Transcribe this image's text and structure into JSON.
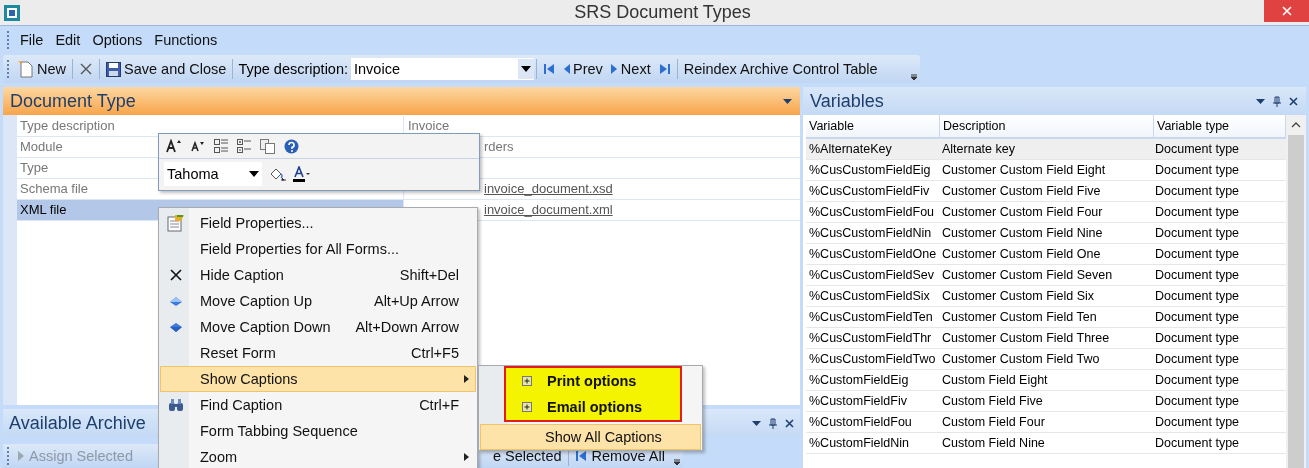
{
  "window": {
    "title": "SRS Document Types"
  },
  "menu": [
    "File",
    "Edit",
    "Options",
    "Functions"
  ],
  "toolbar": {
    "new": "New",
    "save": "Save and Close",
    "type_label": "Type description:",
    "type_value": "Invoice",
    "prev": "Prev",
    "next": "Next",
    "reindex": "Reindex Archive Control Table"
  },
  "document_type": {
    "title": "Document Type",
    "fields": [
      {
        "label": "Type description",
        "value": "Invoice",
        "link": false,
        "selected": false
      },
      {
        "label": "Module",
        "value": "rders",
        "link": false,
        "selected": false
      },
      {
        "label": "Type",
        "selected": false
      },
      {
        "label": "Schema file",
        "value": "invoice_document.xsd",
        "link": true,
        "selected": false
      },
      {
        "label": "XML file",
        "value": "invoice_document.xml",
        "link": true,
        "selected": true
      }
    ]
  },
  "archive": {
    "title": "Available Archive",
    "toolbar": [
      {
        "label": "Assign Selected",
        "disabled": true
      },
      {
        "label": "e Selected",
        "disabled": false
      },
      {
        "label": "Remove All",
        "disabled": false
      }
    ]
  },
  "mini_toolbar": {
    "font": "Tahoma"
  },
  "context_menu": {
    "items": [
      {
        "kind": "properties",
        "label": "Field Properties...",
        "selected": false
      },
      {
        "kind": "plain",
        "label": "Field Properties for All Forms...",
        "selected": false
      },
      {
        "kind": "hide",
        "label": "Hide Caption",
        "shortcut": "Shift+Del",
        "selected": false
      },
      {
        "kind": "up",
        "label": "Move Caption Up",
        "shortcut": "Alt+Up Arrow",
        "selected": false
      },
      {
        "kind": "down",
        "label": "Move Caption Down",
        "shortcut": "Alt+Down Arrow",
        "selected": false
      },
      {
        "kind": "plain",
        "label": "Reset Form",
        "shortcut": "Ctrl+F5",
        "selected": false
      },
      {
        "kind": "submenu",
        "label": "Show Captions",
        "selected": true
      },
      {
        "kind": "find",
        "label": "Find Caption",
        "shortcut": "Ctrl+F",
        "selected": false
      },
      {
        "kind": "plain",
        "label": "Form Tabbing Sequence",
        "selected": false
      },
      {
        "kind": "submenu",
        "label": "Zoom",
        "selected": false
      }
    ]
  },
  "submenu": {
    "items": [
      {
        "kind": "expand",
        "label": "Print options",
        "marked": true,
        "selected": false
      },
      {
        "kind": "expand",
        "label": "Email options",
        "marked": true,
        "selected": false
      },
      {
        "kind": "plain",
        "label": "Show All Captions",
        "marked": false,
        "selected": true
      }
    ]
  },
  "variables": {
    "title": "Variables",
    "columns": [
      "Variable",
      "Description",
      "Variable type"
    ],
    "rows": [
      {
        "cells": [
          "%AlternateKey",
          "Alternate key",
          "Document type"
        ],
        "selected": true
      },
      {
        "cells": [
          "%CusCustomFieldEig",
          "Customer Custom Field Eight",
          "Document type"
        ],
        "selected": false
      },
      {
        "cells": [
          "%CusCustomFieldFiv",
          "Customer Custom Field Five",
          "Document type"
        ],
        "selected": false
      },
      {
        "cells": [
          "%CusCustomFieldFou",
          "Customer Custom Field Four",
          "Document type"
        ],
        "selected": false
      },
      {
        "cells": [
          "%CusCustomFieldNin",
          "Customer Custom Field Nine",
          "Document type"
        ],
        "selected": false
      },
      {
        "cells": [
          "%CusCustomFieldOne",
          "Customer Custom Field One",
          "Document type"
        ],
        "selected": false
      },
      {
        "cells": [
          "%CusCustomFieldSev",
          "Customer Custom Field Seven",
          "Document type"
        ],
        "selected": false
      },
      {
        "cells": [
          "%CusCustomFieldSix",
          "Customer Custom Field Six",
          "Document type"
        ],
        "selected": false
      },
      {
        "cells": [
          "%CusCustomFieldTen",
          "Customer Custom Field Ten",
          "Document type"
        ],
        "selected": false
      },
      {
        "cells": [
          "%CusCustomFieldThr",
          "Customer Custom Field Three",
          "Document type"
        ],
        "selected": false
      },
      {
        "cells": [
          "%CusCustomFieldTwo",
          "Customer Custom Field Two",
          "Document type"
        ],
        "selected": false
      },
      {
        "cells": [
          "%CustomFieldEig",
          "Custom Field Eight",
          "Document type"
        ],
        "selected": false
      },
      {
        "cells": [
          "%CustomFieldFiv",
          "Custom Field Five",
          "Document type"
        ],
        "selected": false
      },
      {
        "cells": [
          "%CustomFieldFou",
          "Custom Field Four",
          "Document type"
        ],
        "selected": false
      },
      {
        "cells": [
          "%CustomFieldNin",
          "Custom Field Nine",
          "Document type"
        ],
        "selected": false
      }
    ]
  }
}
